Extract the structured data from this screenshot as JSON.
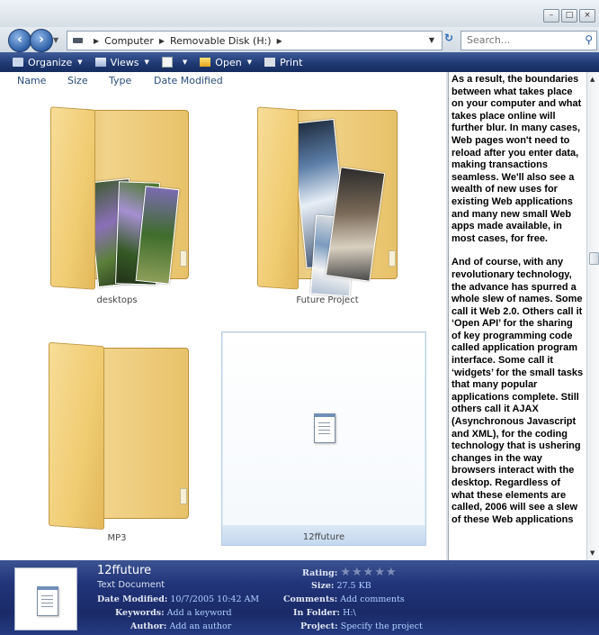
{
  "window": {
    "caption_buttons": [
      "–",
      "□",
      "×"
    ]
  },
  "address": {
    "crumbs": [
      "Computer",
      "Removable Disk (H:)"
    ],
    "search_placeholder": "Search..."
  },
  "commandbar": {
    "organize": "Organize",
    "views": "Views",
    "open": "Open",
    "print": "Print"
  },
  "columns": [
    "Name",
    "Size",
    "Type",
    "Date Modified"
  ],
  "items": [
    {
      "name": "desktops",
      "kind": "folder"
    },
    {
      "name": "Future Project",
      "kind": "folder"
    },
    {
      "name": "MP3",
      "kind": "folder"
    },
    {
      "name": "12ffuture",
      "kind": "text-document",
      "selected": true
    }
  ],
  "preview": {
    "paragraphs": [
      "As a result, the boundaries between what takes place on your computer and what takes place online will further blur. In many cases, Web pages won't need to reload after you enter data, making transactions seamless. We'll also see a wealth of new uses for existing Web applications and many new small Web apps made available, in most cases, for free.",
      "And of course, with any revolutionary technology, the advance has spurred a whole slew of names. Some call it Web 2.0. Others call it ‘Open API’ for the sharing of key programming code called application program interface. Some call it ‘widgets’ for the small tasks that many popular applications complete. Still others call it AJAX (Asynchronous Javascript and XML), for the coding technology that is ushering changes in the way browsers interact with the desktop. Regardless of what these elements are called, 2006 will see a slew of these Web applications"
    ]
  },
  "details": {
    "name": "12ffuture",
    "type": "Text Document",
    "date_modified_label": "Date Modified:",
    "date_modified": "10/7/2005 10:42 AM",
    "keywords_label": "Keywords:",
    "keywords": "Add a keyword",
    "author_label": "Author:",
    "author": "Add an author",
    "rating_label": "Rating:",
    "rating": 0,
    "size_label": "Size:",
    "size": "27.5 KB",
    "comments_label": "Comments:",
    "comments": "Add comments",
    "in_folder_label": "In Folder:",
    "in_folder": "H:\\",
    "project_label": "Project:",
    "project": "Specify the project"
  }
}
